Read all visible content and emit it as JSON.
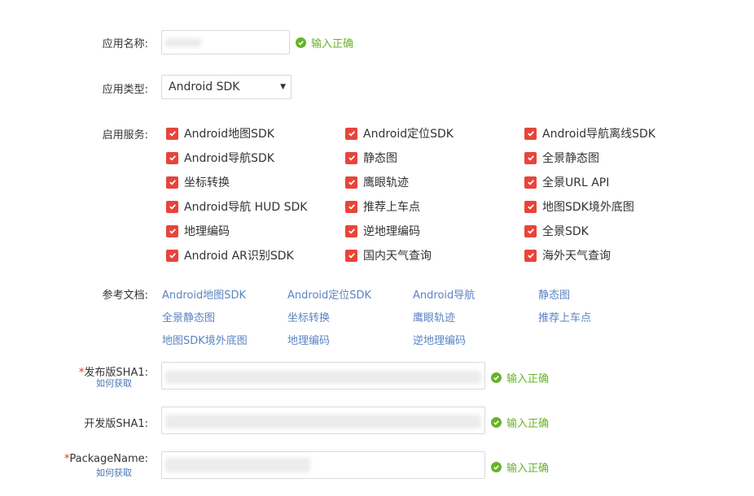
{
  "form": {
    "app_name_label": "应用名称:",
    "app_type_label": "应用类型:",
    "app_type_value": "Android SDK",
    "services_label": "启用服务:",
    "docs_label": "参考文档:",
    "release_sha1_required": "*",
    "release_sha1_label": "发布版SHA1:",
    "dev_sha1_label": "开发版SHA1:",
    "package_required": "*",
    "package_label": "PackageName:",
    "how_to_get": "如何获取",
    "valid_text": "输入正确"
  },
  "services": [
    [
      "Android地图SDK",
      "Android定位SDK",
      "Android导航离线SDK"
    ],
    [
      "Android导航SDK",
      "静态图",
      "全景静态图"
    ],
    [
      "坐标转换",
      "鹰眼轨迹",
      "全景URL API"
    ],
    [
      "Android导航 HUD SDK",
      "推荐上车点",
      "地图SDK境外底图"
    ],
    [
      "地理编码",
      "逆地理编码",
      "全景SDK"
    ],
    [
      "Android AR识别SDK",
      "国内天气查询",
      "海外天气查询"
    ]
  ],
  "docs": [
    [
      "Android地图SDK",
      "Android定位SDK",
      "Android导航",
      "静态图"
    ],
    [
      "全景静态图",
      "坐标转换",
      "鹰眼轨迹",
      "推荐上车点"
    ],
    [
      "地图SDK境外底图",
      "地理编码",
      "逆地理编码"
    ]
  ],
  "colors": {
    "accent_check": "#e8443a",
    "ok_green": "#67b32a",
    "link": "#5b84c2",
    "required": "#e0322a"
  },
  "icons": {
    "checkbox": "checkbox-checked-icon",
    "valid": "check-circle-icon",
    "dropdown": "triangle-down-icon"
  }
}
